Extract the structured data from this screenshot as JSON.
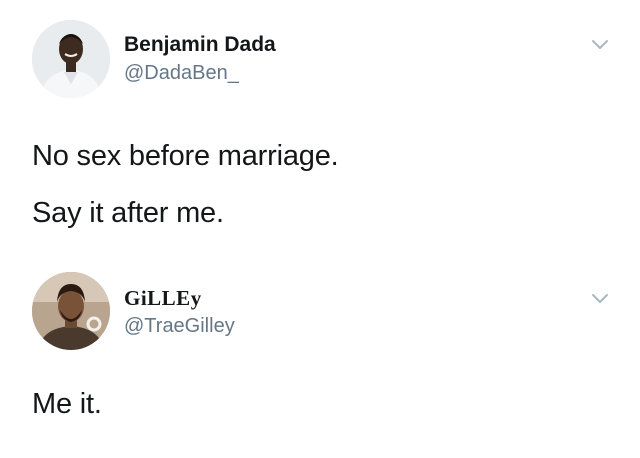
{
  "tweets": [
    {
      "display_name": "Benjamin Dada",
      "handle": "@DadaBen_",
      "text_lines": [
        "No sex before marriage.",
        "Say it after me."
      ],
      "icons": {
        "menu": "chevron-down-icon"
      }
    },
    {
      "display_name": "GiLLEy",
      "handle": "@TraeGilley",
      "text_lines": [
        "Me it."
      ],
      "icons": {
        "menu": "chevron-down-icon"
      }
    }
  ],
  "colors": {
    "text": "#14171a",
    "secondary_text": "#657786",
    "chevron": "#aab8c2",
    "background": "#ffffff"
  }
}
